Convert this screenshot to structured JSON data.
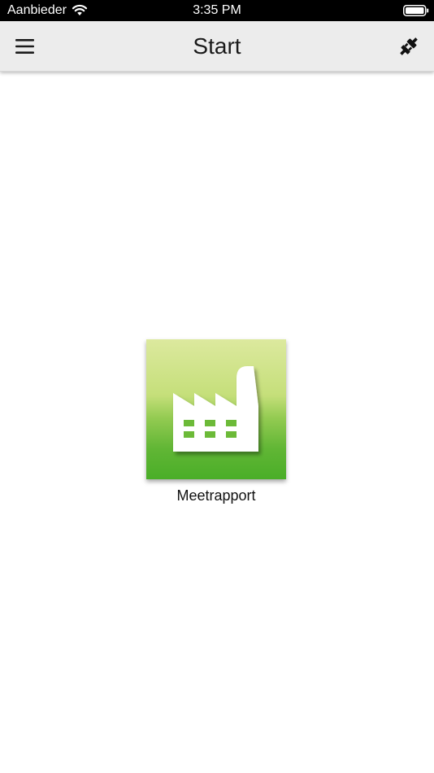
{
  "status_bar": {
    "carrier": "Aanbieder",
    "time": "3:35 PM",
    "wifi_icon": "wifi-icon",
    "battery_icon": "battery-icon"
  },
  "nav_bar": {
    "title": "Start",
    "menu_icon": "hamburger-menu-icon",
    "action_icon": "plug-icon"
  },
  "tiles": [
    {
      "label": "Meetrapport",
      "icon": "factory-icon",
      "colors": {
        "top": "#dce99e",
        "bottom": "#4aae28"
      }
    }
  ],
  "colors": {
    "nav_background": "#ececec",
    "status_background": "#000000",
    "page_background": "#ffffff"
  }
}
